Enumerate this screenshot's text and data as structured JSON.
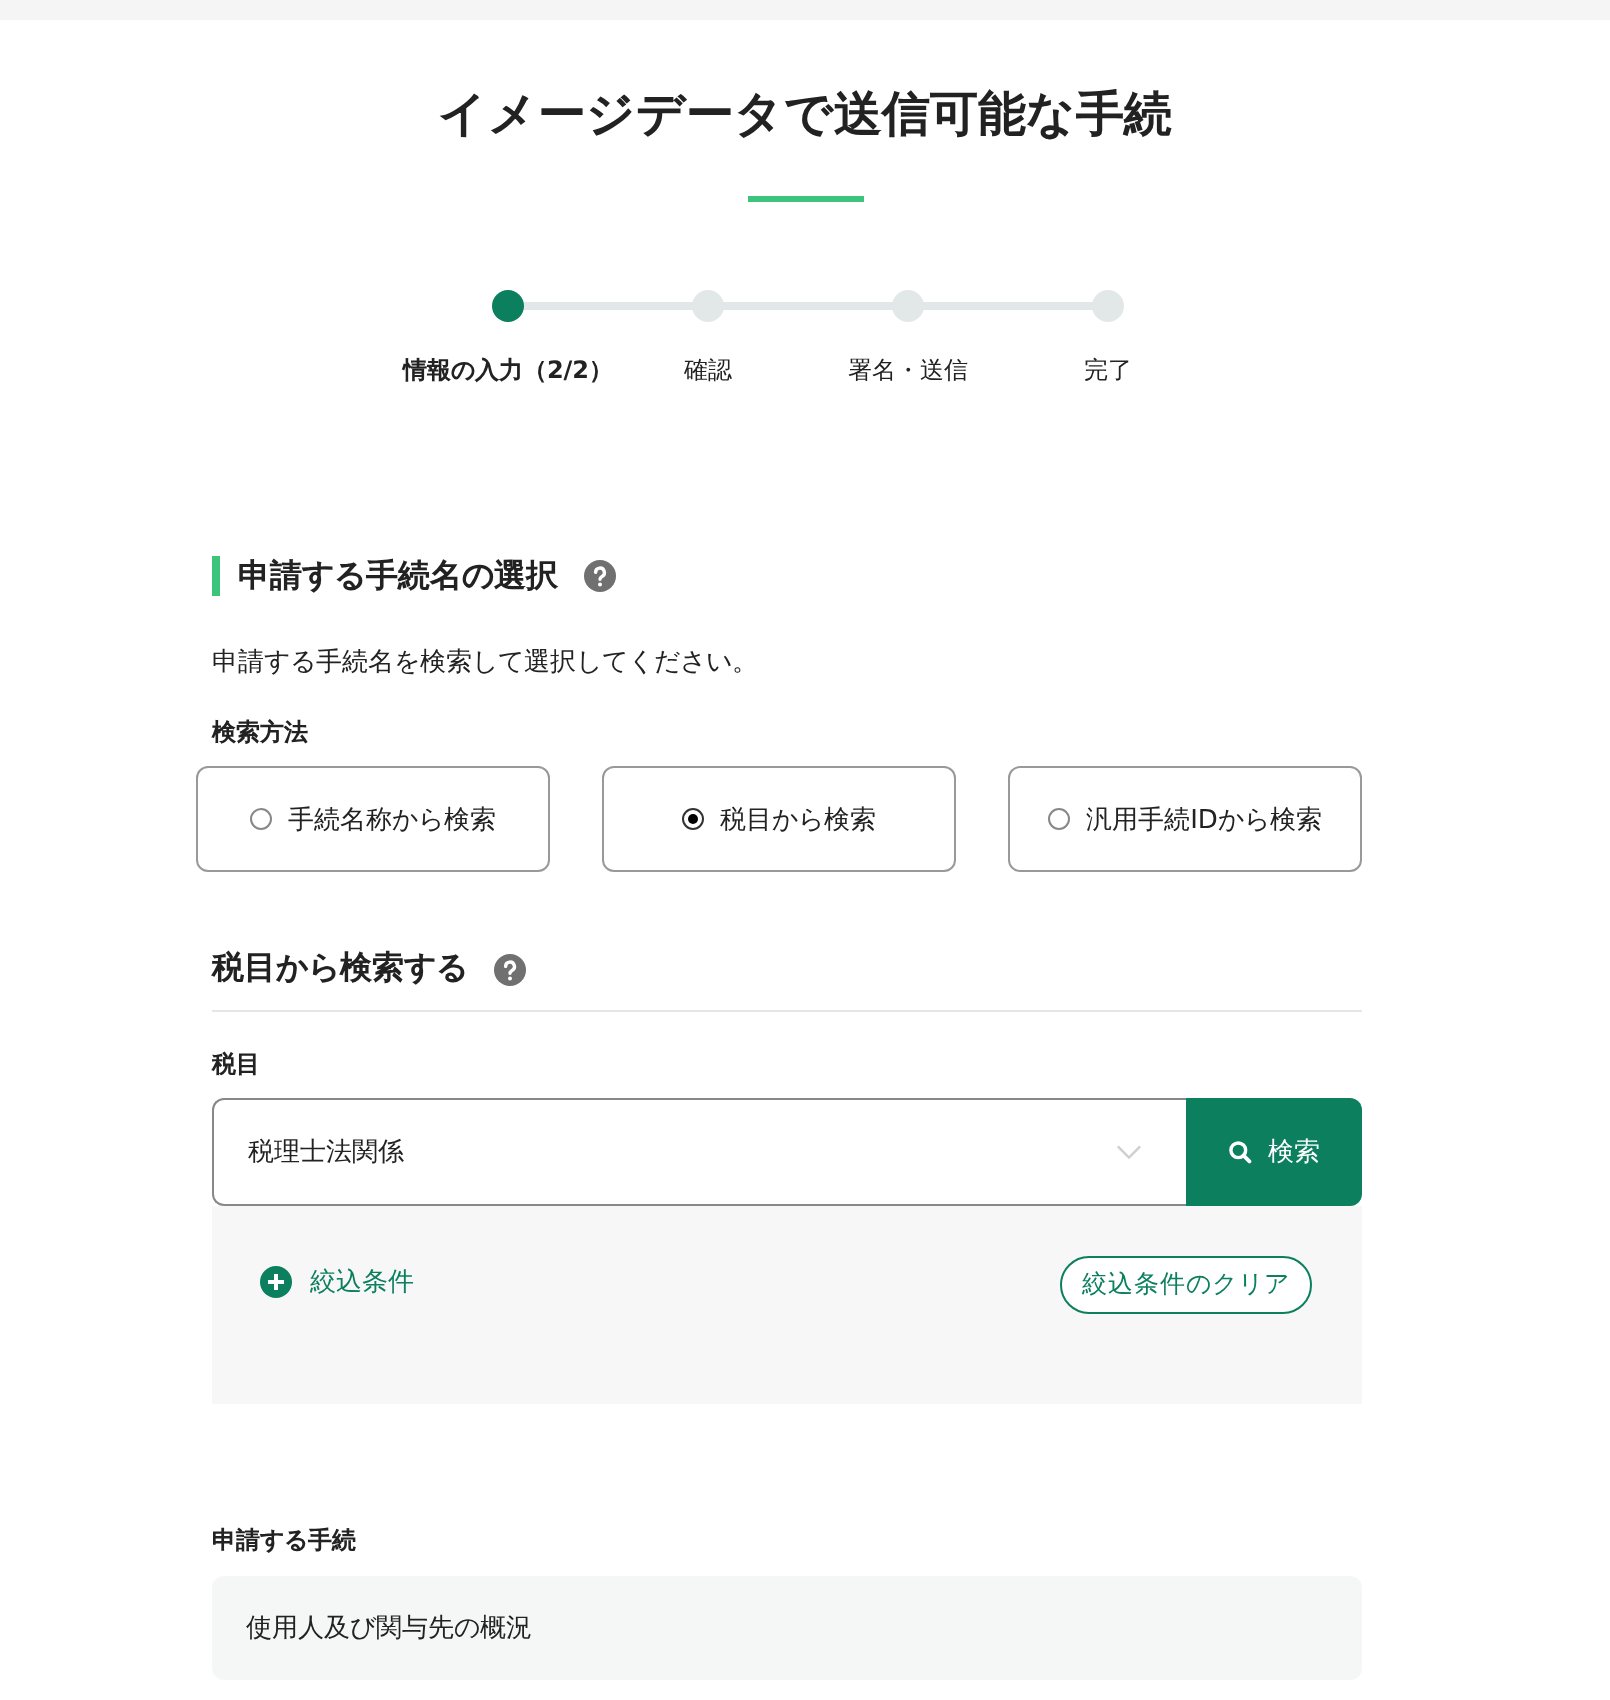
{
  "page_title": "イメージデータで送信可能な手続",
  "steps": [
    {
      "label": "情報の入力（2/2）",
      "current": true
    },
    {
      "label": "確認",
      "current": false
    },
    {
      "label": "署名・送信",
      "current": false
    },
    {
      "label": "完了",
      "current": false
    }
  ],
  "section": {
    "title": "申請する手続名の選択",
    "description": "申請する手続名を検索して選択してください。",
    "method_label": "検索方法",
    "methods": [
      {
        "label": "手続名称から検索",
        "selected": false
      },
      {
        "label": "税目から検索",
        "selected": true
      },
      {
        "label": "汎用手続IDから検索",
        "selected": false
      }
    ]
  },
  "subsection": {
    "title": "税目から検索する",
    "field_label": "税目",
    "select_value": "税理士法関係",
    "search_button": "検索",
    "filter_toggle": "絞込条件",
    "clear_button": "絞込条件のクリア"
  },
  "result": {
    "label": "申請する手続",
    "value": "使用人及び関与先の概況"
  }
}
